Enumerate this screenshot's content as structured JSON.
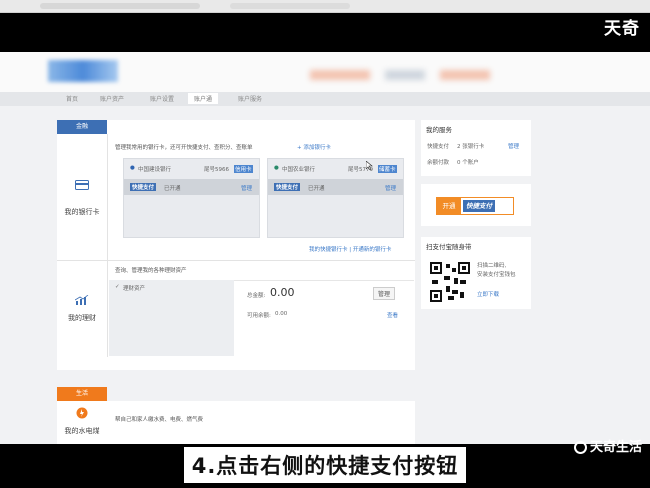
{
  "watermark_top": "天奇",
  "watermark_bottom": "天奇生活",
  "caption": "4.点击右侧的快捷支付按钮",
  "nav": {
    "items": [
      "首页",
      "账户资产",
      "账户设置",
      "账户通",
      "账户服务"
    ]
  },
  "finance_section": {
    "tab_label": "金融",
    "bank_card": {
      "label": "我的银行卡",
      "description": "管理我常用的银行卡，还可开快捷支付、查积分、查账单",
      "add_link": "+ 添加银行卡",
      "cards": [
        {
          "bank": "中国建设银行",
          "tail": "尾号5966",
          "tag": "信用卡",
          "status": "已开通",
          "manage": "管理"
        },
        {
          "bank": "中国农业银行",
          "tail": "尾号5779",
          "tag": "储蓄卡",
          "status": "已开通",
          "manage": "管理"
        }
      ],
      "quick_pay_logo": "快捷支付",
      "links": "我的快捷银行卡 | 开通新的银行卡"
    },
    "finance": {
      "label": "我的理财",
      "description": "查询、管理我的各种理财资产",
      "asset_title": "理财资产",
      "total_label": "总金额:",
      "total_value": "0.00",
      "manage": "管理",
      "available_label": "可用余额:",
      "available_value": "0.00",
      "query": "查看"
    }
  },
  "life_section": {
    "tab_label": "生活",
    "label": "我的水电煤",
    "description": "帮自己和家人缴水费、电费、燃气费"
  },
  "services": {
    "title": "我的服务",
    "row1_label": "快捷支付",
    "row1_value": "2 张银行卡",
    "row1_action": "管理",
    "row2_label": "余额付款",
    "row2_value": "0 个账户"
  },
  "quickpay_button": {
    "open": "开通",
    "label": "快捷支付"
  },
  "qr_panel": {
    "title": "扫支付宝随身带",
    "desc1": "扫描二维码,",
    "desc2": "安装支付宝钱包",
    "link": "立即下载"
  },
  "colors": {
    "finance_tab": "#3d6fb4",
    "life_tab": "#f07a1c",
    "quickpay_orange": "#f28c26",
    "quickpay_blue": "#3d6fb4"
  }
}
